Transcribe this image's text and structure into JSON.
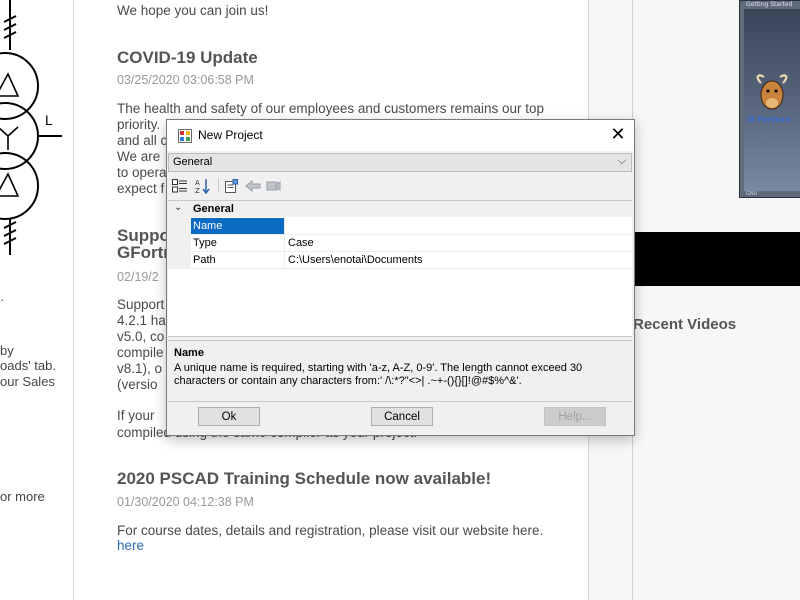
{
  "left_fragments": {
    "label_L": "L",
    "dot": "·",
    "line_by": "by",
    "line_oads": "oads' tab.",
    "line_our_sales": "our Sales",
    "line_or_more": "or more"
  },
  "article": {
    "intro_line": "We hope you can join us!",
    "covid_title": "COVID-19 Update",
    "covid_date": "03/25/2020 03:06:58 PM",
    "covid_line1": "The health and safety of our employees and customers remains our top",
    "covid_line2": "priority.",
    "covid_line3": "and all c",
    "covid_line4": "We are",
    "covid_line5": "to opera",
    "covid_line6": "expect f",
    "support_title_1": "Suppo",
    "support_title_2": "GFortr",
    "support_date": "02/19/2",
    "support_line1": "Support",
    "support_line2": "4.2.1 ha",
    "support_line3": "v5.0, co",
    "support_line4": "compile",
    "support_line5": "v8.1), o",
    "support_line6": "(versio",
    "support_line7": "If your",
    "support_line8": "compiled using the same compiler as your project.",
    "training_title": "2020 PSCAD Training Schedule now available!",
    "training_date": "01/30/2020 04:12:38 PM",
    "training_line1": "For course dates, details and registration, please visit our website here.",
    "training_link": "here"
  },
  "sidebar": {
    "video_thumb_title": "Getting Started",
    "video_thumb_caption": "G Fortran",
    "video_thumb_small": "GNU",
    "recent_videos": "Recent Videos"
  },
  "dialog": {
    "title": "New Project",
    "category_dropdown_value": "General",
    "grid_category": "General",
    "properties": [
      {
        "name": "Name",
        "value": ""
      },
      {
        "name": "Type",
        "value": "Case"
      },
      {
        "name": "Path",
        "value": "C:\\Users\\enotai\\Documents"
      }
    ],
    "help_title": "Name",
    "help_text": "A unique name is required, starting with 'a-z, A-Z, 0-9'. The length cannot exceed 30 characters or contain any characters from:' /\\:*?\"<>| .~+-(){}[]!@#$%^&'.",
    "buttons": {
      "ok": "Ok",
      "cancel": "Cancel",
      "help": "Help..."
    }
  },
  "colors": {
    "selection": "#0a6bc4",
    "link": "#2a6cb8",
    "dialog_bg": "#f0f0f0"
  },
  "icons": [
    "project-icon",
    "close-icon",
    "chevron-down-icon",
    "categorized-icon",
    "sort-alpha-icon",
    "property-pages-icon",
    "back-icon",
    "forward-icon",
    "collapse-arrow-icon"
  ]
}
